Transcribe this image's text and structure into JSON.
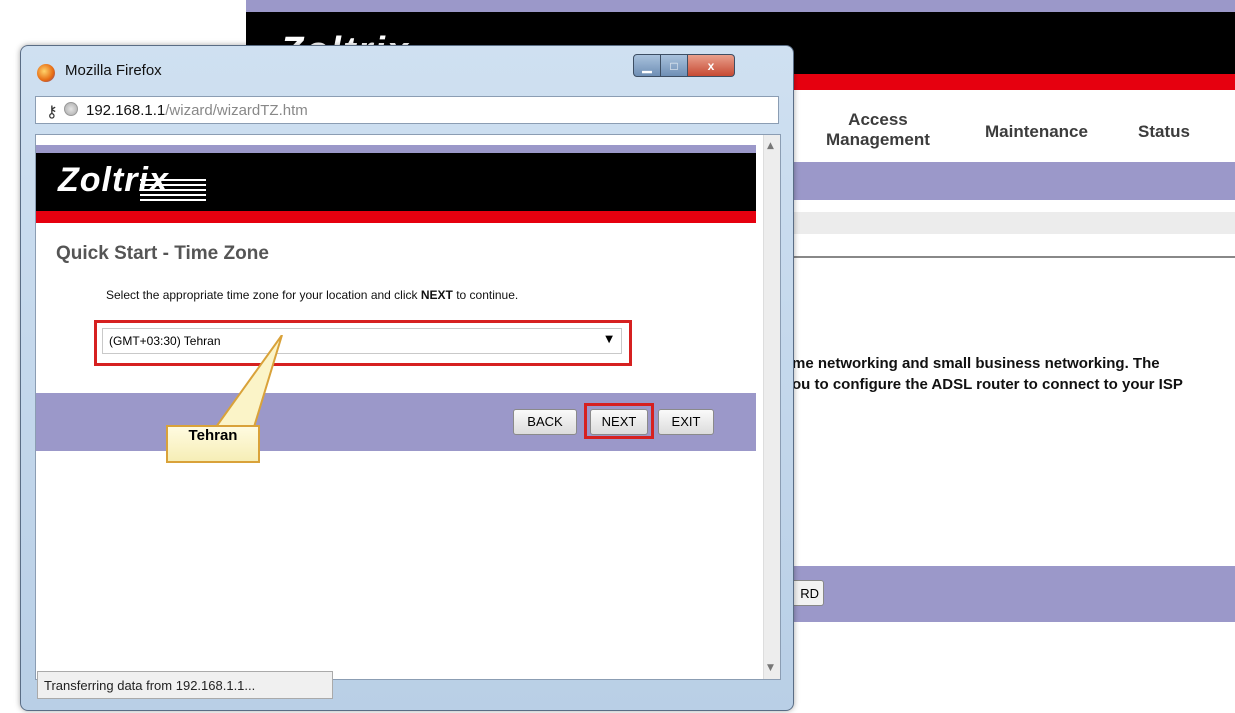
{
  "background_page": {
    "logo": "Zoltrix",
    "nav": [
      {
        "label_line1": "Access",
        "label_line2": "Management"
      },
      {
        "label": "Maintenance"
      },
      {
        "label": "Status"
      }
    ],
    "body_line1": "me networking and small business networking. The",
    "body_line2": "ou to configure the ADSL router to connect to your ISP",
    "wizard_button_fragment": "RD"
  },
  "popup": {
    "window_title": "Mozilla Firefox",
    "url_host": "192.168.1.1",
    "url_path": "/wizard/wizardTZ.htm",
    "logo": "Zoltrix",
    "heading": "Quick Start - Time Zone",
    "instruction_prefix": "Select the appropriate time zone for your location and click ",
    "instruction_bold": "NEXT",
    "instruction_suffix": " to continue.",
    "timezone_selected": "(GMT+03:30) Tehran",
    "buttons": {
      "back": "BACK",
      "next": "NEXT",
      "exit": "EXIT"
    },
    "status_text": "Transferring data from 192.168.1.1..."
  },
  "annotation": {
    "callout_text": "Tehran",
    "highlight_color": "#d62020"
  },
  "colors": {
    "brand_purple": "#9b98c9",
    "brand_red": "#e6000f",
    "brand_black": "#000000"
  },
  "icons": [
    "firefox-icon",
    "minimize-icon",
    "maximize-icon",
    "close-icon",
    "key-icon",
    "globe-icon",
    "chevron-down-icon",
    "scroll-up-icon",
    "scroll-down-icon"
  ]
}
